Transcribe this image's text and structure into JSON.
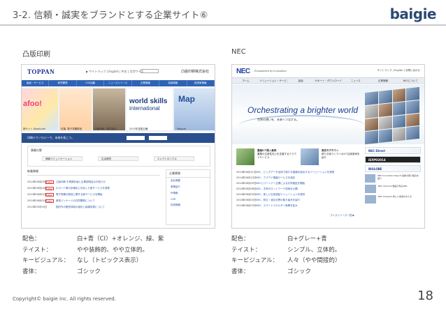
{
  "slide": {
    "title": "3-2. 信頼・誠実をブランドとする企業サイト⑥",
    "brand": "baigie",
    "footer": "Copyright© baigie inc. All rights reserved.",
    "page_number": "18"
  },
  "examples": [
    {
      "name": "凸版印刷",
      "screenshot": {
        "logo": "TOPPAN",
        "util_links": "▶ サイトマップ | English | 中文 | 文字サイズ",
        "corp_name": "凸版印刷株式会社",
        "nav": [
          "製品・サービス",
          "研究開発",
          "CSR活動",
          "ニュースリリース",
          "企業情報",
          "採用情報",
          "投資家情報"
        ],
        "banner_text_1": "afoo!",
        "banner_text_2": "world skills",
        "banner_text_2b": "international",
        "banner_text_3": "Map",
        "captions": [
          "新サイト BookLive!",
          "紅葉, 電子書籍配信",
          "凸版印刷・株式会社",
          "2015年技能五輪",
          "Mapple"
        ],
        "strip_text": "印刷テクノロジーで、未来を拓こう。",
        "business_title": "事業分野",
        "business_chips": [
          "情報コミュニケーション",
          "生活環境",
          "エレクトロニクス"
        ],
        "news_title": "新着情報",
        "news": [
          {
            "date": "2014年06月05日",
            "tag": "NEW",
            "text": "凸版印刷 中長期計画と企業説明会のお知らせ"
          },
          {
            "date": "2014年06月04日",
            "tag": "NEW",
            "text": "ICカード等の多様化に対応した新サービスを発表"
          },
          {
            "date": "2014年06月02日",
            "tag": "NEW",
            "text": "電子書籍の配信に関する新サービスを開始"
          },
          {
            "date": "2014年06月02日",
            "tag": "NEW",
            "text": "新型パッケージの共同開発について"
          },
          {
            "date": "2014年05月30日",
            "tag": "",
            "text": "国内外の販売体制の強化と組織変更について"
          }
        ],
        "side_title": "企業情報",
        "side_items": [
          "会社概要",
          "事業紹介",
          "IR情報",
          "CSR",
          "採用情報"
        ]
      },
      "specs": [
        {
          "key": "配色：",
          "value": "白+青（CI）+オレンジ、緑、紫"
        },
        {
          "key": "テイスト：",
          "value": "やや装飾的、やや立体的。"
        },
        {
          "key": "キービジュアル：",
          "value": "なし（トピックス表示）"
        },
        {
          "key": "書体：",
          "value": "ゴシック"
        }
      ]
    },
    {
      "name": "NEC",
      "screenshot": {
        "logo": "NEC",
        "tagline": "Empowered by Innovation",
        "util_links": "サイトマップ | English | お問い合わせ",
        "nav": [
          "ホーム",
          "ソリューション・サービス",
          "製品",
          "サポート・ダウンロード",
          "ニュース",
          "企業情報",
          "NECについて"
        ],
        "hero_heading": "Orchestrating a brighter world",
        "hero_sub": "世界の想いを、未来へつなげる。",
        "cards": [
          {
            "title": "農業ICT導入事例",
            "text": "農業の生産性向上を支援するクラウドサービス"
          },
          {
            "title": "東京モデタウン",
            "text": "新たな街づくりへのICT活用事例を紹介"
          }
        ],
        "news": [
          {
            "date": "2014年06月11日",
            "text": "NEC、ビッグデータ活用で新たな価値を創出するソリューションを発表"
          },
          {
            "date": "2014年06月10日",
            "text": "NEC、クラウド基盤サービスを強化"
          },
          {
            "date": "2014年06月09日",
            "text": "NECとパートナー企業による共同実証を開始"
          },
          {
            "date": "2014年06月06日",
            "text": "NEC、次世代ネットワーク技術を公開"
          },
          {
            "date": "2014年06月05日",
            "text": "NEC、新しい生体認証ソリューションを提供"
          },
          {
            "date": "2014年06月04日",
            "text": "NEC、防災・減災分野の取り組みを紹介"
          },
          {
            "date": "2014年06月03日",
            "text": "NEC、スマートエネルギー事業を拡大"
          }
        ],
        "more_link": "プレスリリース一覧 ▶",
        "side_blocks": [
          "NEC Direct",
          "iEXPO2014",
          "BIGLOBE"
        ],
        "side_items": [
          {
            "text": "NEC Innovation Report 最新の取り組みを紹介"
          },
          {
            "text": "NEC Channel 動画で知るNEC"
          },
          {
            "text": "NEC Presents 新しい未来のかたち"
          }
        ]
      },
      "specs": [
        {
          "key": "配色：",
          "value": "白+グレー+青"
        },
        {
          "key": "テイスト：",
          "value": "シンプル、立体的。"
        },
        {
          "key": "キービジュアル：",
          "value": "人々（やや間接的）"
        },
        {
          "key": "書体：",
          "value": "ゴシック"
        }
      ]
    }
  ]
}
